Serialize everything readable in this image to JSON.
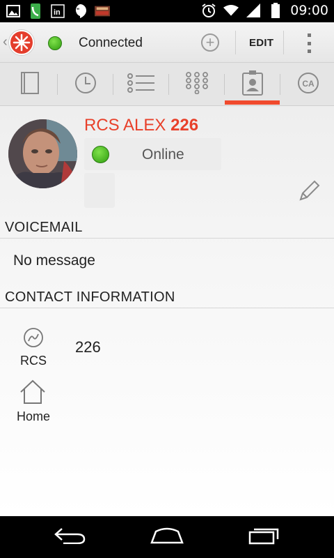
{
  "status_bar": {
    "time": "09:00",
    "left_icons": [
      "image-icon",
      "phone-icon",
      "linkedin-icon",
      "hangouts-icon",
      "game-icon"
    ],
    "right_icons": [
      "alarm-icon",
      "wifi-icon",
      "signal-icon",
      "battery-icon"
    ]
  },
  "action_bar": {
    "status_label": "Connected",
    "edit_label": "EDIT",
    "status_color": "#3aa317"
  },
  "tabs": [
    {
      "name": "tab-notebook",
      "icon": "notebook-icon"
    },
    {
      "name": "tab-history",
      "icon": "clock-icon"
    },
    {
      "name": "tab-list",
      "icon": "list-icon"
    },
    {
      "name": "tab-dialpad",
      "icon": "dialpad-icon"
    },
    {
      "name": "tab-contacts",
      "icon": "contact-card-icon",
      "selected": true
    },
    {
      "name": "tab-ca",
      "icon": "ca-icon",
      "label": "CA"
    }
  ],
  "contact": {
    "name_prefix": "RCS ALEX",
    "name_number": "226",
    "presence": "Online",
    "accent_color": "#e8402a"
  },
  "voicemail": {
    "header": "VOICEMAIL",
    "message": "No message"
  },
  "contact_information": {
    "header": "CONTACT INFORMATION",
    "entries": [
      {
        "icon": "rcs-icon",
        "label": "RCS",
        "value": "226"
      },
      {
        "icon": "home-icon",
        "label": "Home",
        "value": ""
      }
    ]
  }
}
